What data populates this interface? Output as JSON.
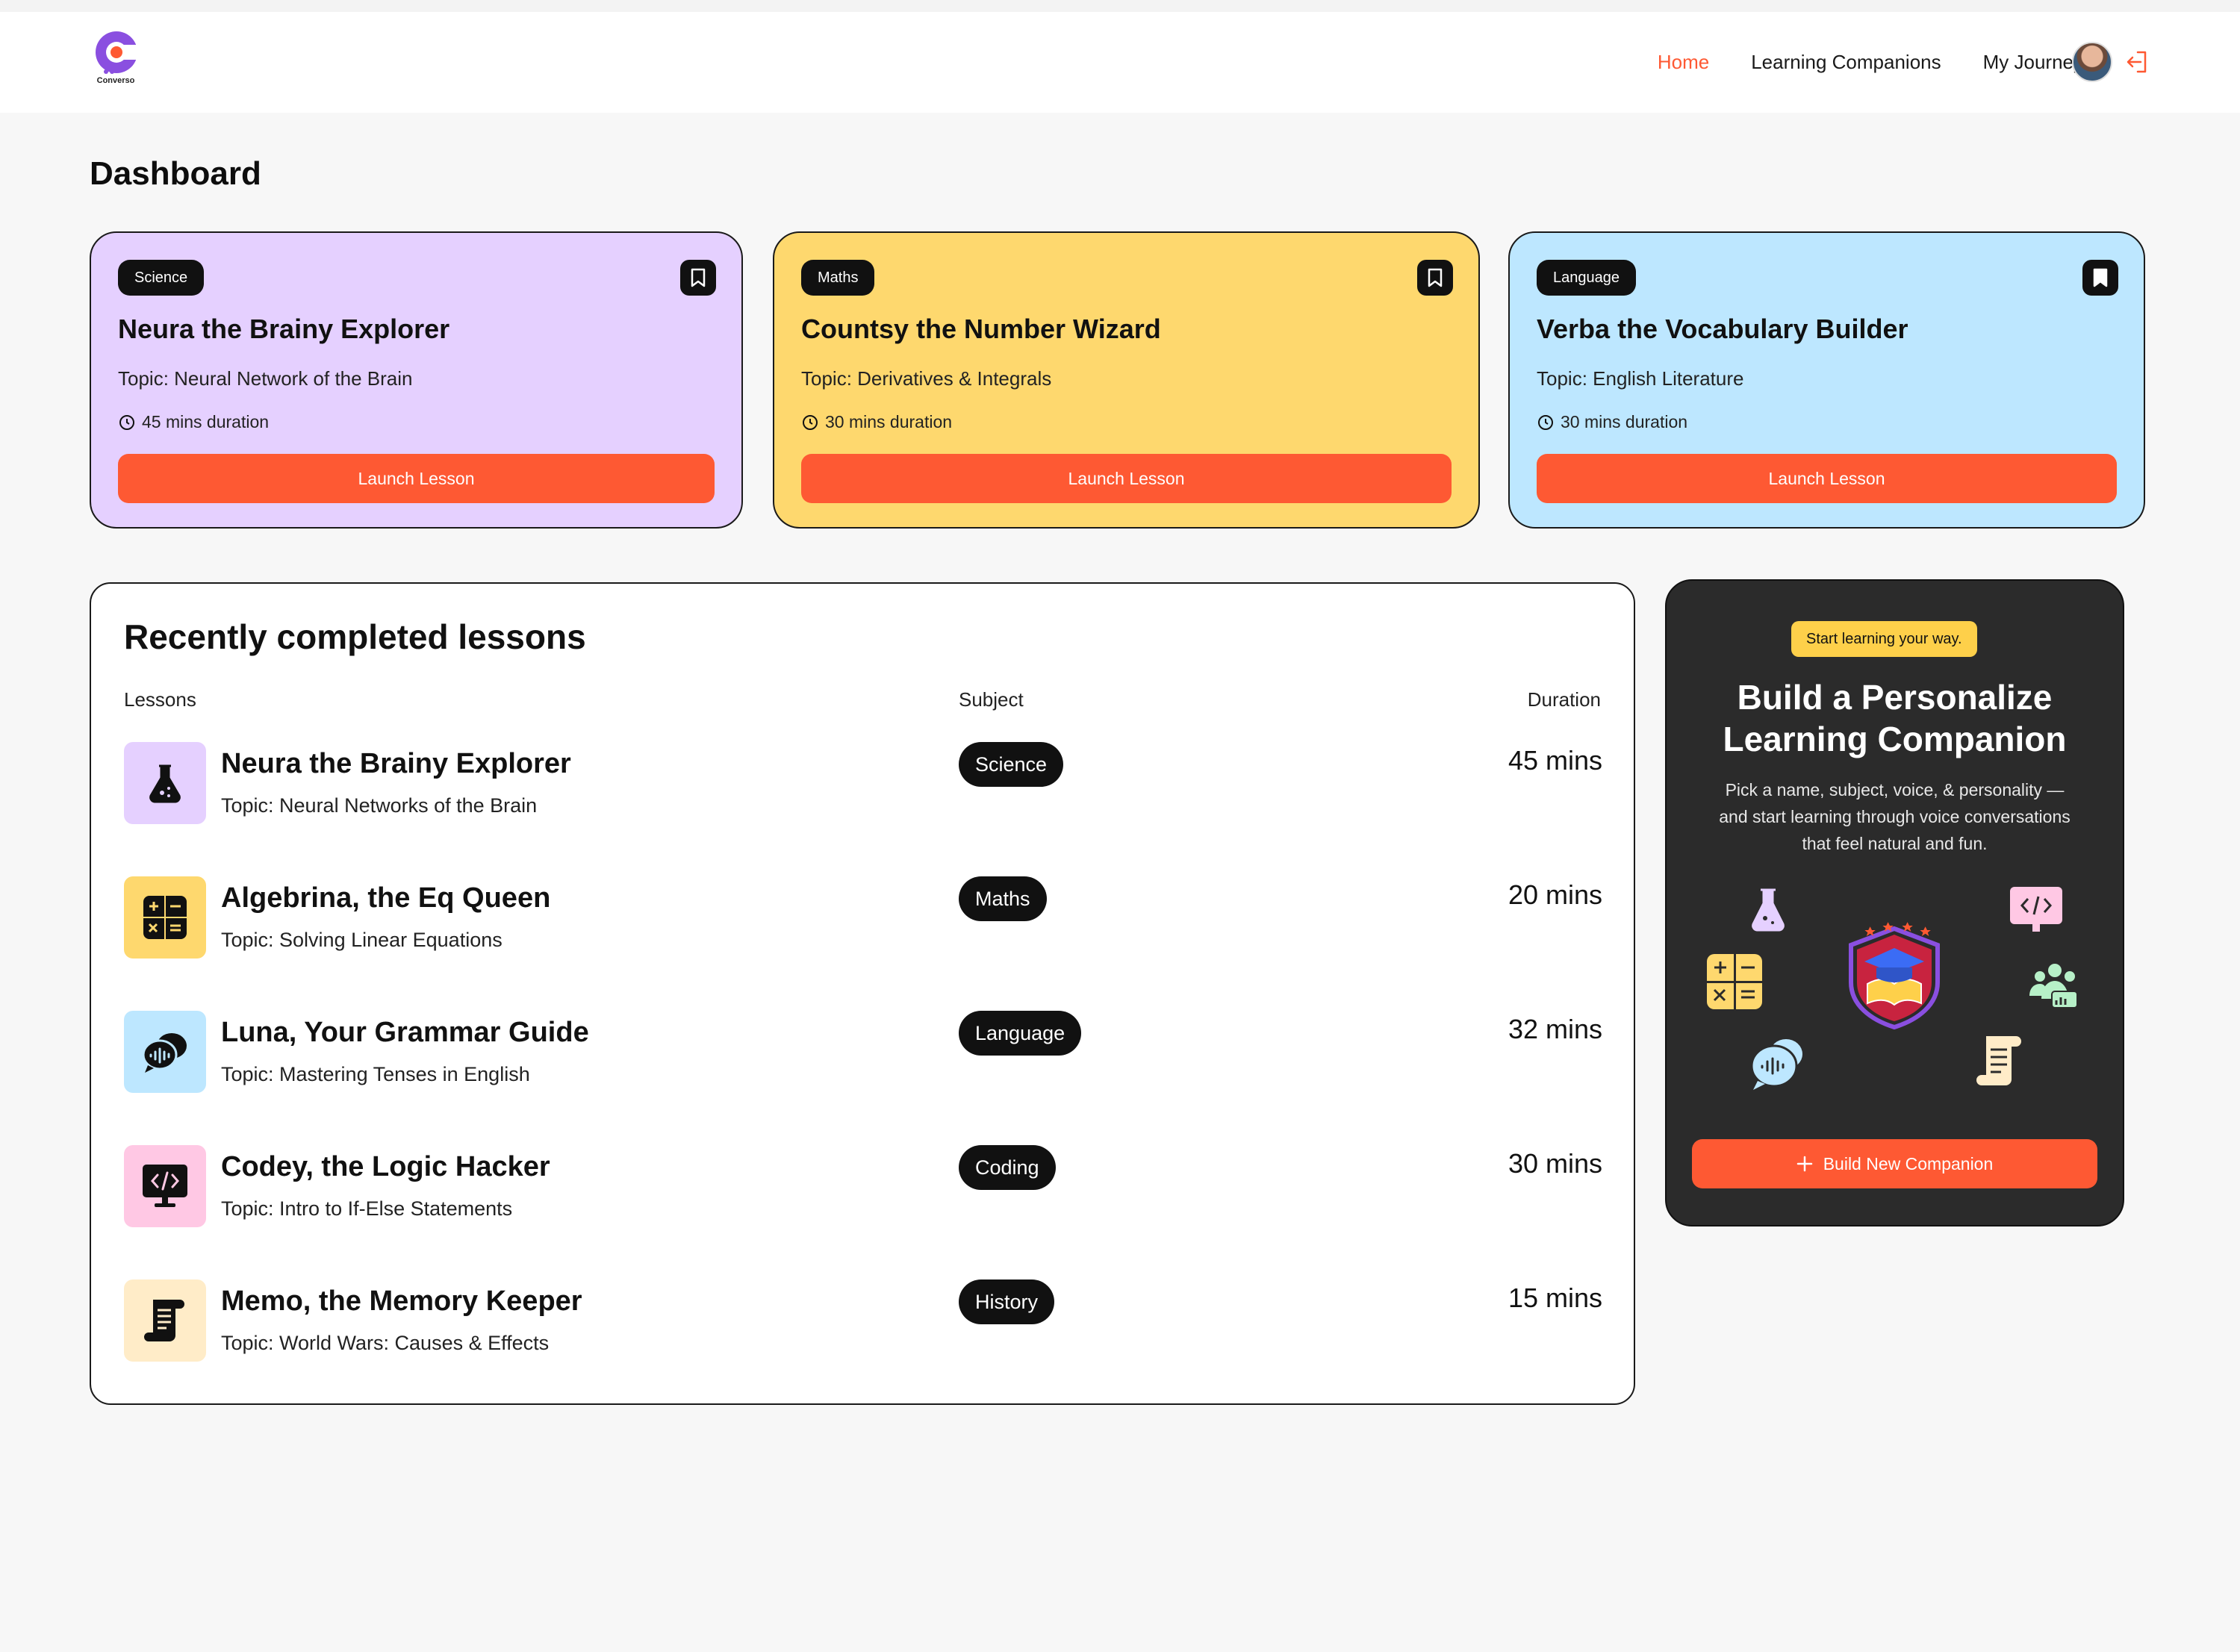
{
  "app": {
    "logo_text": "Converso"
  },
  "nav": {
    "home": "Home",
    "companions": "Learning Companions",
    "journey": "My Journey"
  },
  "page": {
    "title": "Dashboard"
  },
  "cards": [
    {
      "tag": "Science",
      "title": "Neura the Brainy Explorer",
      "topic": "Topic: Neural Network of the Brain",
      "duration": "45 mins duration",
      "button": "Launch Lesson",
      "color": "#e5d0ff",
      "bookmarked": false
    },
    {
      "tag": "Maths",
      "title": "Countsy the Number Wizard",
      "topic": "Topic: Derivatives & Integrals",
      "duration": "30 mins duration",
      "button": "Launch Lesson",
      "color": "#fed86e",
      "bookmarked": false
    },
    {
      "tag": "Language",
      "title": "Verba the Vocabulary Builder",
      "topic": "Topic: English Literature",
      "duration": "30 mins duration",
      "button": "Launch Lesson",
      "color": "#bde7ff",
      "bookmarked": true
    }
  ],
  "recent": {
    "title": "Recently completed lessons",
    "col_lessons": "Lessons",
    "col_subject": "Subject",
    "col_duration": "Duration",
    "rows": [
      {
        "name": "Neura the Brainy Explorer",
        "topic": "Topic: Neural Networks of the Brain",
        "subject": "Science",
        "duration": "45 mins",
        "icon": "flask-icon",
        "color": "#e5d0ff"
      },
      {
        "name": "Algebrina, the Eq Queen",
        "topic": "Topic: Solving Linear Equations",
        "subject": "Maths",
        "duration": "20 mins",
        "icon": "calculator-icon",
        "color": "#fed86e"
      },
      {
        "name": "Luna, Your Grammar Guide",
        "topic": "Topic: Mastering Tenses in English",
        "subject": "Language",
        "duration": "32 mins",
        "icon": "chat-bubbles-icon",
        "color": "#bde7ff"
      },
      {
        "name": "Codey, the Logic Hacker",
        "topic": "Topic: Intro to If-Else Statements",
        "subject": "Coding",
        "duration": "30 mins",
        "icon": "code-monitor-icon",
        "color": "#ffc8e4"
      },
      {
        "name": "Memo, the Memory Keeper",
        "topic": "Topic: World Wars: Causes & Effects",
        "subject": "History",
        "duration": "15 mins",
        "icon": "scroll-icon",
        "color": "#ffecc8"
      }
    ]
  },
  "cta": {
    "pill": "Start learning your way.",
    "heading": "Build a Personalize Learning Companion",
    "body": "Pick a name, subject, voice, & personality — and start learning through voice conversations that feel natural and fun.",
    "button": "Build New Companion"
  },
  "colors": {
    "accent": "#fe5933",
    "dark": "#2b2b2b",
    "yellow": "#fed04a"
  }
}
